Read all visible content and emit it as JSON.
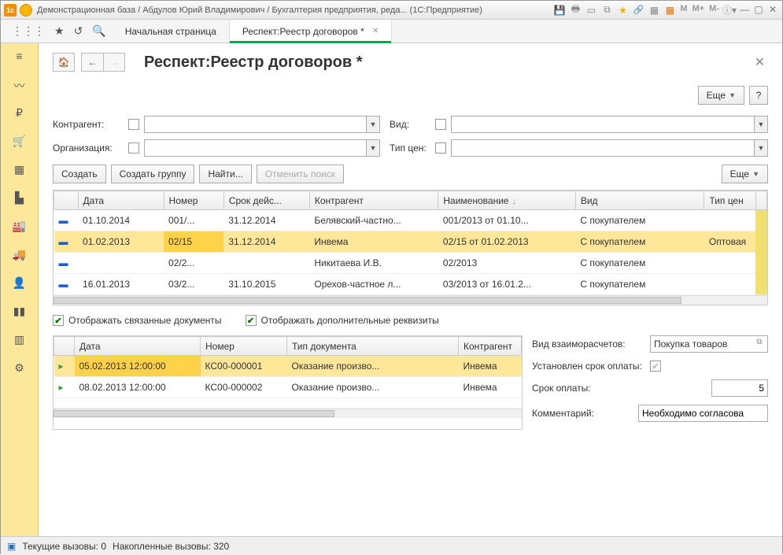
{
  "titlebar": {
    "title": "Демонстрационная база / Абдулов Юрий Владимирович / Бухгалтерия предприятия, реда...   (1С:Предприятие)",
    "mem": [
      "M",
      "M+",
      "M-"
    ]
  },
  "tabs": {
    "home": "Начальная страница",
    "active": "Респект:Реестр договоров *"
  },
  "page": {
    "title": "Респект:Реестр договоров *"
  },
  "buttons": {
    "more": "Еще",
    "help": "?",
    "create": "Создать",
    "create_group": "Создать группу",
    "find": "Найти...",
    "cancel_search": "Отменить поиск"
  },
  "filters": {
    "counterparty_label": "Контрагент:",
    "organization_label": "Организация:",
    "type_label": "Вид:",
    "price_type_label": "Тип цен:"
  },
  "columns": {
    "date": "Дата",
    "number": "Номер",
    "validity": "Срок дейс...",
    "counterparty": "Контрагент",
    "name": "Наименование",
    "type": "Вид",
    "price_type": "Тип цен"
  },
  "rows": [
    {
      "date": "01.10.2014",
      "num": "001/...",
      "valid": "31.12.2014",
      "cp": "Белявский-частно...",
      "name": "001/2013 от 01.10...",
      "type": "С покупателем",
      "ptype": ""
    },
    {
      "date": "01.02.2013",
      "num": "02/15",
      "valid": "31.12.2014",
      "cp": "Инвема",
      "name": "02/15 от 01.02.2013",
      "type": "С покупателем",
      "ptype": "Оптовая"
    },
    {
      "date": "",
      "num": "02/2...",
      "valid": "",
      "cp": "Никитаева И.В.",
      "name": "02/2013",
      "type": "С покупателем",
      "ptype": ""
    },
    {
      "date": "16.01.2013",
      "num": "03/2...",
      "valid": "31.10.2015",
      "cp": "Орехов-частное л...",
      "name": "03/2013 от 16.01.2...",
      "type": "С покупателем",
      "ptype": ""
    }
  ],
  "checks": {
    "related": "Отображать связанные документы",
    "extra": "Отображать дополнительные реквизиты"
  },
  "sub_columns": {
    "date": "Дата",
    "number": "Номер",
    "doctype": "Тип документа",
    "counterparty": "Контрагент"
  },
  "sub_rows": [
    {
      "date": "05.02.2013 12:00:00",
      "num": "КС00-000001",
      "type": "Оказание произво...",
      "cp": "Инвема"
    },
    {
      "date": "08.02.2013 12:00:00",
      "num": "КС00-000002",
      "type": "Оказание произво...",
      "cp": "Инвема"
    }
  ],
  "details": {
    "settlement_label": "Вид взаиморасчетов:",
    "settlement_value": "Покупка товаров",
    "deadline_set_label": "Установлен срок оплаты:",
    "deadline_label": "Срок оплаты:",
    "deadline_value": "5",
    "comment_label": "Комментарий:",
    "comment_value": "Необходимо согласова"
  },
  "status": {
    "current": "Текущие вызовы: 0",
    "accum": "Накопленные вызовы: 320"
  }
}
